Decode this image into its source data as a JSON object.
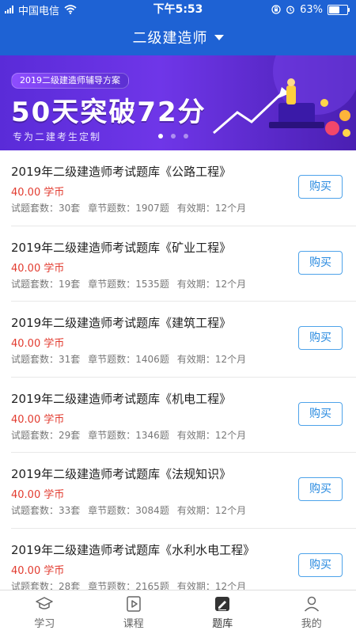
{
  "status_bar": {
    "carrier": "中国电信",
    "time": "下午5:53",
    "battery": "63%",
    "battery_level": 0.63
  },
  "header": {
    "title": "二级建造师",
    "dropdown_icon": "caret-down-icon"
  },
  "banner": {
    "tag": "2019二级建造师辅导方案",
    "headline": "50天突破72分",
    "subtitle": "专为二建考生定制",
    "slide_count": 3,
    "active_slide": 1
  },
  "courses": [
    {
      "title": "2019年二级建造师考试题库《公路工程》",
      "price": "40.00 学币",
      "sets": "试题套数：30套",
      "chapters": "章节题数：1907题",
      "validity": "有效期：12个月",
      "buy": "购买"
    },
    {
      "title": "2019年二级建造师考试题库《矿业工程》",
      "price": "40.00 学币",
      "sets": "试题套数：19套",
      "chapters": "章节题数：1535题",
      "validity": "有效期：12个月",
      "buy": "购买"
    },
    {
      "title": "2019年二级建造师考试题库《建筑工程》",
      "price": "40.00 学币",
      "sets": "试题套数：31套",
      "chapters": "章节题数：1406题",
      "validity": "有效期：12个月",
      "buy": "购买"
    },
    {
      "title": "2019年二级建造师考试题库《机电工程》",
      "price": "40.00 学币",
      "sets": "试题套数：29套",
      "chapters": "章节题数：1346题",
      "validity": "有效期：12个月",
      "buy": "购买"
    },
    {
      "title": "2019年二级建造师考试题库《法规知识》",
      "price": "40.00 学币",
      "sets": "试题套数：33套",
      "chapters": "章节题数：3084题",
      "validity": "有效期：12个月",
      "buy": "购买"
    },
    {
      "title": "2019年二级建造师考试题库《水利水电工程》",
      "price": "40.00 学币",
      "sets": "试题套数：28套",
      "chapters": "章节题数：2165题",
      "validity": "有效期：12个月",
      "buy": "购买"
    }
  ],
  "tabs": [
    {
      "label": "学习",
      "icon": "graduation-cap-icon"
    },
    {
      "label": "课程",
      "icon": "play-video-icon"
    },
    {
      "label": "题库",
      "icon": "question-bank-icon",
      "active": true
    },
    {
      "label": "我的",
      "icon": "user-icon"
    }
  ],
  "colors": {
    "primary": "#1e62d4",
    "price": "#e23b2f",
    "button": "#2a8be0"
  }
}
